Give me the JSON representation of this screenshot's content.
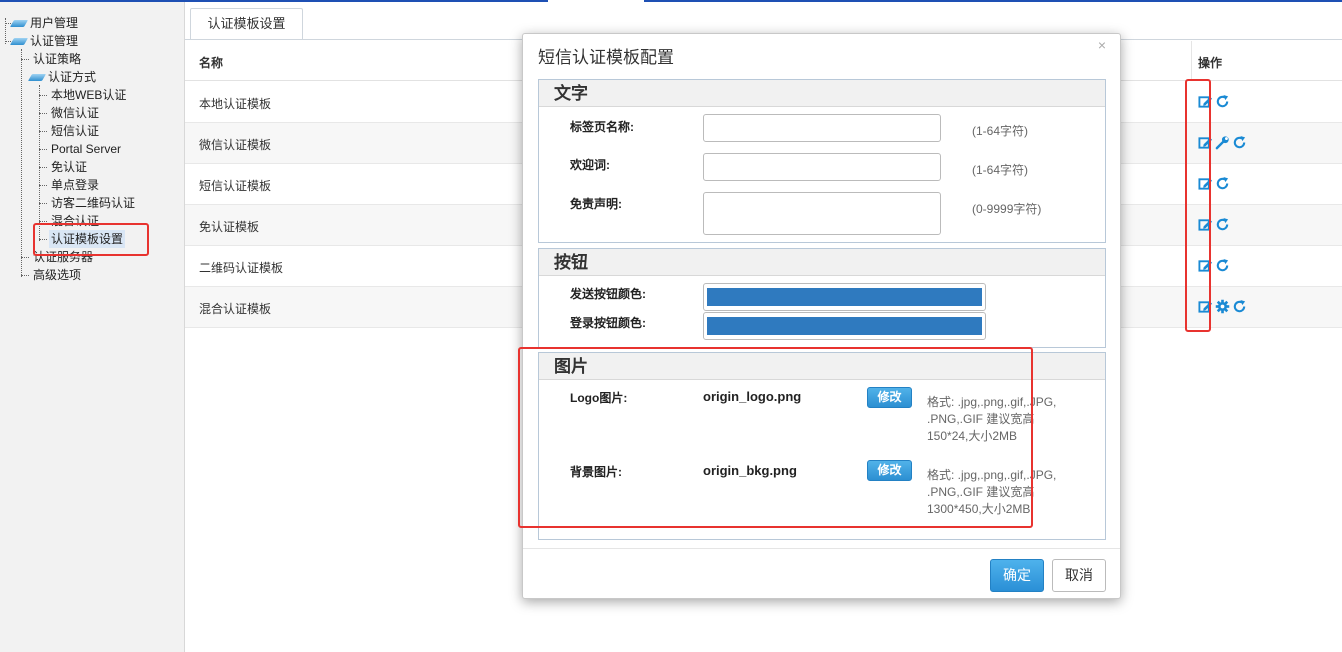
{
  "sidebar": {
    "items": [
      {
        "label": "用户管理",
        "level": 0,
        "folder": true
      },
      {
        "label": "认证管理",
        "level": 0,
        "folder": true
      },
      {
        "label": "认证策略",
        "level": 1,
        "folder": false
      },
      {
        "label": "认证方式",
        "level": 1,
        "folder": true
      },
      {
        "label": "本地WEB认证",
        "level": 2,
        "folder": false
      },
      {
        "label": "微信认证",
        "level": 2,
        "folder": false
      },
      {
        "label": "短信认证",
        "level": 2,
        "folder": false
      },
      {
        "label": "Portal Server",
        "level": 2,
        "folder": false
      },
      {
        "label": "免认证",
        "level": 2,
        "folder": false
      },
      {
        "label": "单点登录",
        "level": 2,
        "folder": false
      },
      {
        "label": "访客二维码认证",
        "level": 2,
        "folder": false
      },
      {
        "label": "混合认证",
        "level": 2,
        "folder": false
      },
      {
        "label": "认证模板设置",
        "level": 2,
        "folder": false,
        "selected": true
      },
      {
        "label": "认证服务器",
        "level": 1,
        "folder": false
      },
      {
        "label": "高级选项",
        "level": 1,
        "folder": false
      }
    ]
  },
  "tab": {
    "label": "认证模板设置"
  },
  "table": {
    "col_name": "名称",
    "col_ops": "操作",
    "rows": [
      {
        "name": "本地认证模板",
        "ops": [
          "edit-icon",
          "refresh-icon"
        ]
      },
      {
        "name": "微信认证模板",
        "ops": [
          "edit-icon",
          "wrench-icon",
          "refresh-icon"
        ]
      },
      {
        "name": "短信认证模板",
        "ops": [
          "edit-icon",
          "refresh-icon"
        ]
      },
      {
        "name": "免认证模板",
        "ops": [
          "edit-icon",
          "refresh-icon"
        ]
      },
      {
        "name": "二维码认证模板",
        "ops": [
          "edit-icon",
          "refresh-icon"
        ]
      },
      {
        "name": "混合认证模板",
        "ops": [
          "edit-icon",
          "gear-icon",
          "refresh-icon"
        ]
      }
    ]
  },
  "modal": {
    "title": "短信认证模板配置",
    "close": "×",
    "text_section": {
      "title": "文字",
      "tab_name_label": "标签页名称:",
      "tab_name_value": "",
      "tab_name_hint": "(1-64字符)",
      "welcome_label": "欢迎词:",
      "welcome_value": "",
      "welcome_hint": "(1-64字符)",
      "disclaimer_label": "免责声明:",
      "disclaimer_value": "",
      "disclaimer_hint": "(0-9999字符)"
    },
    "button_section": {
      "title": "按钮",
      "send_label": "发送按钮颜色:",
      "send_color": "#2f7abf",
      "login_label": "登录按钮颜色:",
      "login_color": "#2f7abf"
    },
    "image_section": {
      "title": "图片",
      "logo_label": "Logo图片:",
      "logo_file": "origin_logo.png",
      "logo_modify": "修改",
      "logo_format_1": "格式: .jpg,.png,.gif,.JPG,",
      "logo_format_2": ".PNG,.GIF 建议宽高",
      "logo_format_3": "150*24,大小2MB",
      "bg_label": "背景图片:",
      "bg_file": "origin_bkg.png",
      "bg_modify": "修改",
      "bg_format_1": "格式: .jpg,.png,.gif,.JPG,",
      "bg_format_2": ".PNG,.GIF 建议宽高",
      "bg_format_3": "1300*450,大小2MB"
    },
    "ok": "确定",
    "cancel": "取消"
  },
  "colors": {
    "accent": "#1e50b4",
    "icon_blue": "#1a8ad4",
    "highlight_red": "#e8332f"
  }
}
